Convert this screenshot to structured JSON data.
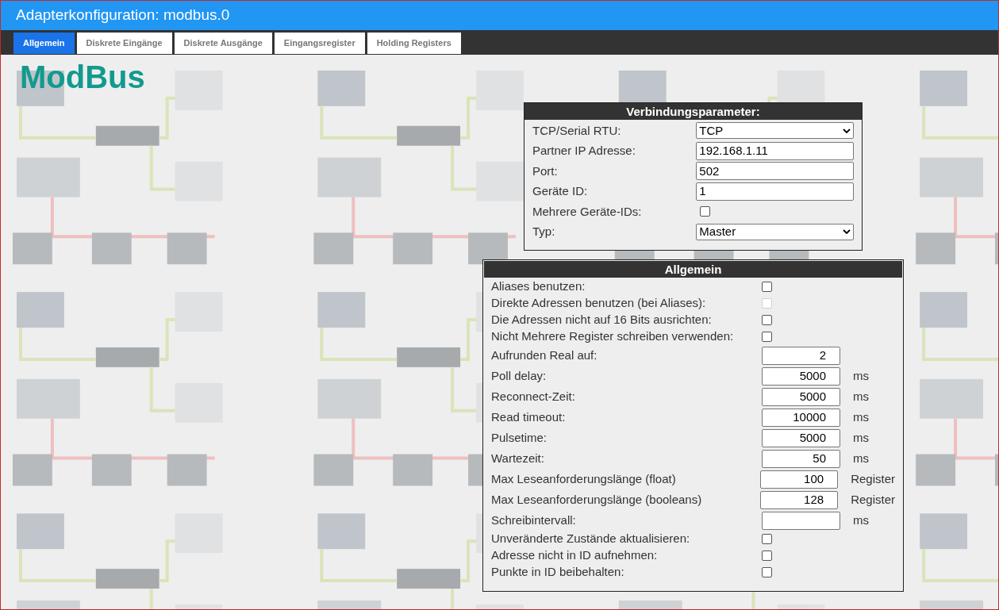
{
  "window": {
    "title": "Adapterkonfiguration: modbus.0"
  },
  "tabs": [
    {
      "label": "Allgemein",
      "selected": true
    },
    {
      "label": "Diskrete Eingänge",
      "selected": false
    },
    {
      "label": "Diskrete Ausgänge",
      "selected": false
    },
    {
      "label": "Eingangsregister",
      "selected": false
    },
    {
      "label": "Holding Registers",
      "selected": false
    }
  ],
  "heading": "ModBus",
  "connection": {
    "title": "Verbindungsparameter:",
    "fields": [
      {
        "kind": "select",
        "label": "TCP/Serial RTU:",
        "value": "TCP"
      },
      {
        "kind": "text",
        "label": "Partner IP Adresse:",
        "value": "192.168.1.11"
      },
      {
        "kind": "text",
        "label": "Port:",
        "value": "502"
      },
      {
        "kind": "text",
        "label": "Geräte ID:",
        "value": "1"
      },
      {
        "kind": "checkbox",
        "label": "Mehrere Geräte-IDs:",
        "checked": false,
        "disabled": false
      },
      {
        "kind": "select",
        "label": "Typ:",
        "value": "Master"
      }
    ]
  },
  "general": {
    "title": "Allgemein",
    "fields": [
      {
        "kind": "checkbox",
        "label": "Aliases benutzen:",
        "checked": false,
        "disabled": false
      },
      {
        "kind": "checkbox",
        "label": "Direkte Adressen benutzen (bei Aliases):",
        "checked": false,
        "disabled": true
      },
      {
        "kind": "checkbox",
        "label": "Die Adressen nicht auf 16 Bits ausrichten:",
        "checked": false,
        "disabled": false
      },
      {
        "kind": "checkbox",
        "label": "Nicht Mehrere Register schreiben verwenden:",
        "checked": false,
        "disabled": false
      },
      {
        "kind": "number",
        "label": "Aufrunden Real auf:",
        "value": "2"
      },
      {
        "kind": "number",
        "label": "Poll delay:",
        "value": "5000",
        "unit": "ms"
      },
      {
        "kind": "number",
        "label": "Reconnect-Zeit:",
        "value": "5000",
        "unit": "ms"
      },
      {
        "kind": "number",
        "label": "Read timeout:",
        "value": "10000",
        "unit": "ms"
      },
      {
        "kind": "number",
        "label": "Pulsetime:",
        "value": "5000",
        "unit": "ms"
      },
      {
        "kind": "number",
        "label": "Wartezeit:",
        "value": "50",
        "unit": "ms"
      },
      {
        "kind": "number",
        "label": "Max Leseanforderungslänge (float)",
        "value": "100",
        "unit": "Register"
      },
      {
        "kind": "number",
        "label": "Max Leseanforderungslänge (booleans)",
        "value": "128",
        "unit": "Register"
      },
      {
        "kind": "number",
        "label": "Schreibintervall:",
        "unit": "ms"
      },
      {
        "kind": "checkbox",
        "label": "Unveränderte Zustände aktualisieren:",
        "checked": false,
        "disabled": false
      },
      {
        "kind": "checkbox",
        "label": "Adresse nicht in ID aufnehmen:",
        "checked": false,
        "disabled": false
      },
      {
        "kind": "checkbox",
        "label": "Punkte in ID beibehalten:",
        "checked": false,
        "disabled": false
      }
    ]
  }
}
